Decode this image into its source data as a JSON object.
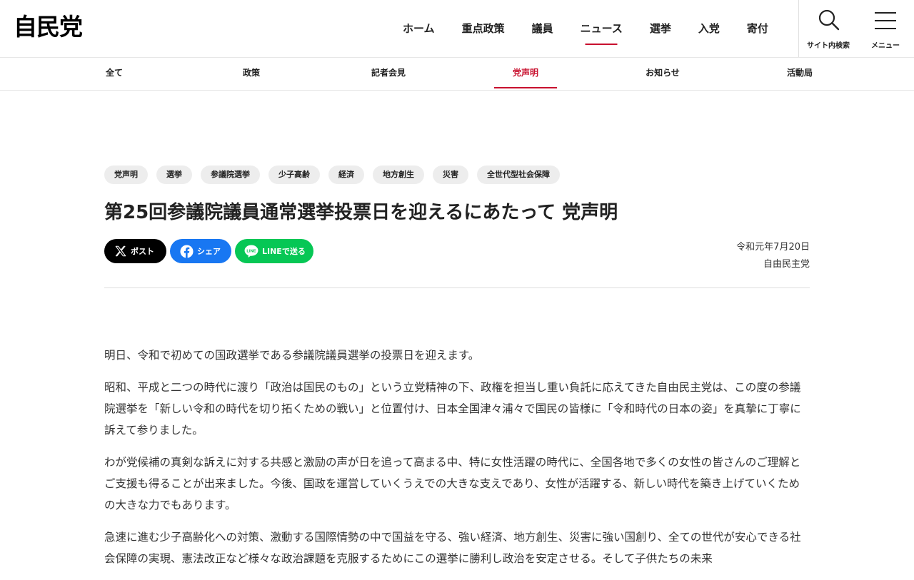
{
  "header": {
    "logo": "自民党",
    "nav": [
      "ホーム",
      "重点政策",
      "議員",
      "ニュース",
      "選挙",
      "入党",
      "寄付"
    ],
    "active_nav": "ニュース",
    "search_label": "サイト内検索",
    "menu_label": "メニュー"
  },
  "sub_nav": {
    "items": [
      "全て",
      "政策",
      "記者会見",
      "党声明",
      "お知らせ",
      "活動局"
    ],
    "active": "党声明"
  },
  "article": {
    "tags": [
      "党声明",
      "選挙",
      "参議院選挙",
      "少子高齢",
      "経済",
      "地方創生",
      "災害",
      "全世代型社会保障"
    ],
    "title": "第25回参議院議員通常選挙投票日を迎えるにあたって 党声明",
    "share": {
      "x": "ポスト",
      "facebook": "シェア",
      "line": "LINEで送る"
    },
    "date": "令和元年7月20日",
    "author": "自由民主党",
    "paragraphs": [
      "明日、令和で初めての国政選挙である参議院議員選挙の投票日を迎えます。",
      "昭和、平成と二つの時代に渡り「政治は国民のもの」という立党精神の下、政権を担当し重い負託に応えてきた自由民主党は、この度の参議院選挙を「新しい令和の時代を切り拓くための戦い」と位置付け、日本全国津々浦々で国民の皆様に「令和時代の日本の姿」を真摯に丁寧に訴えて参りました。",
      "わが党候補の真剣な訴えに対する共感と激励の声が日を追って高まる中、特に女性活躍の時代に、全国各地で多くの女性の皆さんのご理解とご支援も得ることが出来ました。今後、国政を運営していくうえでの大きな支えであり、女性が活躍する、新しい時代を築き上げていくための大きな力でもあります。",
      "急速に進む少子高齢化への対策、激動する国際情勢の中で国益を守る、強い経済、地方創生、災害に強い国創り、全ての世代が安心できる社会保障の実現、憲法改正など様々な政治課題を克服するためにこの選挙に勝利し政治を安定させる。そして子供たちの未来"
    ]
  }
}
